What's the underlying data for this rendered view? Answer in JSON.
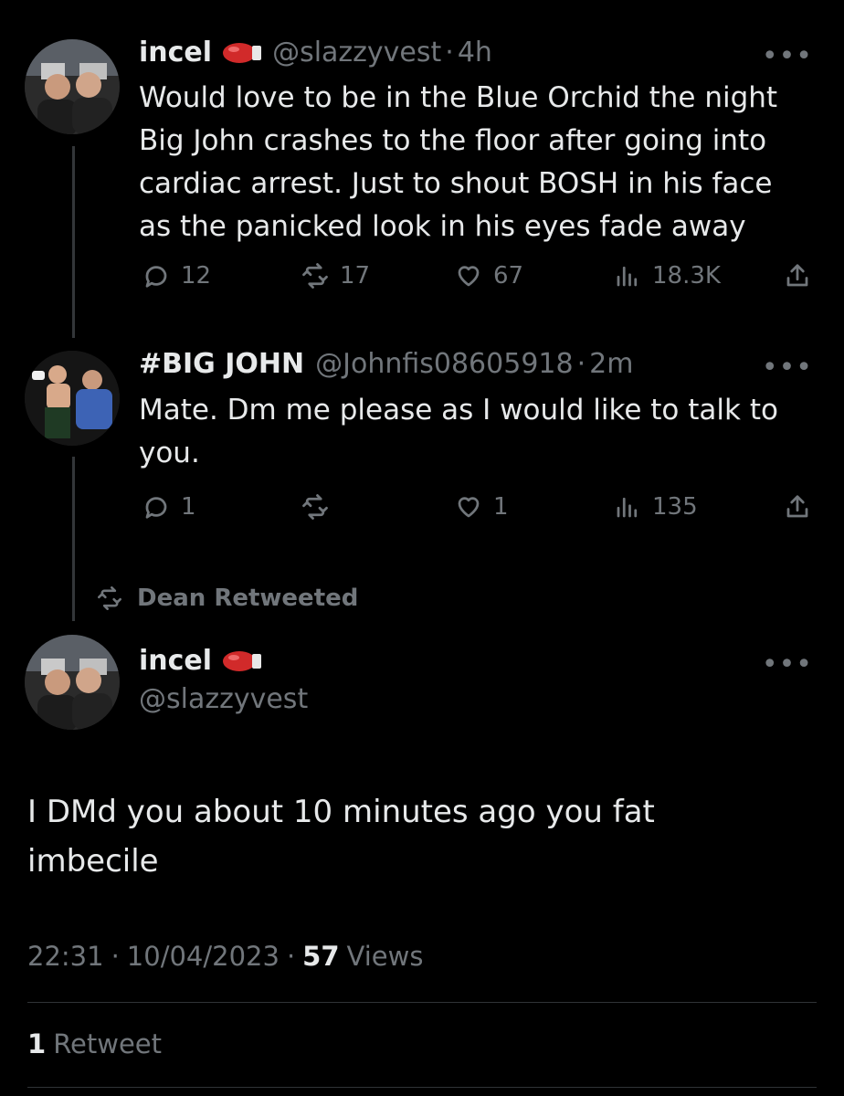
{
  "tweet1": {
    "name": "incel",
    "handle": "@slazzyvest",
    "time": "4h",
    "text_lines": [
      "Would love to be in the Blue Orchid the night",
      "Big John crashes to the floor after going into",
      "cardiac arrest. Just to shout BOSH in his  face",
      "as the panicked look in his eyes fade away"
    ],
    "replies": "12",
    "retweets": "17",
    "likes": "67",
    "views": "18.3K"
  },
  "tweet2": {
    "name": "#BIG JOHN",
    "handle": "@Johnfis08605918",
    "time": "2m",
    "text_lines": [
      "Mate. Dm me please as I would like to talk to",
      "you."
    ],
    "replies": "1",
    "retweets": "",
    "likes": "1",
    "views": "135"
  },
  "retweet_context": {
    "label": "Dean Retweeted"
  },
  "main_tweet": {
    "name": "incel",
    "handle": "@slazzyvest",
    "text_lines": [
      "I DMd you about 10 minutes ago you fat",
      "imbecile"
    ],
    "time": "22:31",
    "date": "10/04/2023",
    "views_count": "57",
    "views_label": "Views",
    "retweet_count": "1",
    "retweet_label": "Retweet"
  },
  "separator": "·",
  "more_glyph": "•••",
  "icons": [
    "boxing-glove-icon",
    "reply-icon",
    "retweet-icon",
    "like-icon",
    "views-icon",
    "share-icon",
    "more-icon"
  ],
  "colors": {
    "background": "#000000",
    "text": "#e7e9ea",
    "muted": "#71767b",
    "glove": "#d12a2a"
  }
}
